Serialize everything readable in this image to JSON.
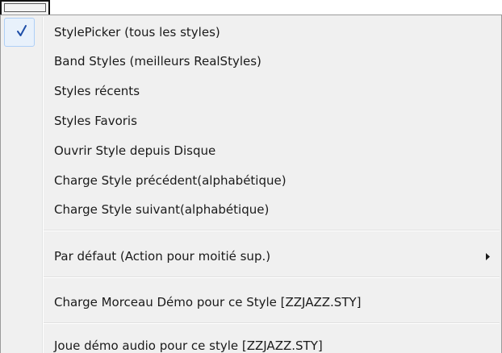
{
  "menu": {
    "items": [
      {
        "label": "StylePicker (tous les styles)",
        "checked": true
      },
      {
        "label": "Band Styles (meilleurs RealStyles)"
      },
      {
        "label": "Styles récents"
      },
      {
        "label": "Styles Favoris"
      },
      {
        "label": "Ouvrir Style depuis Disque"
      },
      {
        "label": "Charge Style précédent(alphabétique)"
      },
      {
        "label": "Charge Style suivant(alphabétique)"
      },
      {
        "label": "Par défaut (Action pour moitié sup.)",
        "submenu": true
      },
      {
        "label": "Charge Morceau Démo pour ce Style  [ZZJAZZ.STY]"
      },
      {
        "label": "Joue démo audio pour ce style [ZZJAZZ.STY]"
      }
    ],
    "icons": {
      "check": "check-icon",
      "submenu": "submenu-arrow-icon"
    },
    "colors": {
      "background": "#f0f0f0",
      "check_highlight": "#e8f1fb",
      "check_border": "#aecff7",
      "check_mark": "#1f4fa8",
      "text": "#1a1a1a"
    }
  }
}
